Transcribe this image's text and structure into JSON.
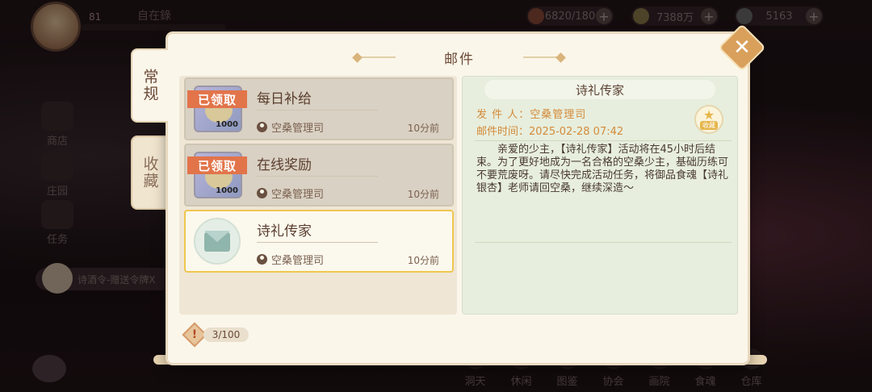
{
  "hud": {
    "level": "81",
    "name": "自在錄",
    "resources": [
      {
        "icon": "stamina-icon",
        "value": "6820/180"
      },
      {
        "icon": "coin-icon",
        "value": "7388万"
      },
      {
        "icon": "gem-icon",
        "value": "5163"
      }
    ]
  },
  "side": {
    "shop": "商店",
    "manor": "庄园",
    "tasks": "任务",
    "chat_preview": "诗酒令-赠送令牌X"
  },
  "bottom_nav": [
    "洞天",
    "休闲",
    "图鉴",
    "协会",
    "画院",
    "食魂",
    "仓库"
  ],
  "mail": {
    "title": "邮件",
    "tabs": {
      "normal": "常规",
      "favorites": "收藏"
    },
    "items": [
      {
        "title": "每日补给",
        "sender": "空桑管理司",
        "time": "10分前",
        "claimed_label": "已领取",
        "qty": "1000"
      },
      {
        "title": "在线奖励",
        "sender": "空桑管理司",
        "time": "10分前",
        "claimed_label": "已领取",
        "qty": "1000"
      },
      {
        "title": "诗礼传家",
        "sender": "空桑管理司",
        "time": "10分前"
      }
    ],
    "count": "3/100",
    "detail": {
      "title": "诗礼传家",
      "sender_line": "发 件 人：空桑管理司",
      "time_line": "邮件时间：2025-02-28  07:42",
      "favorite_label": "收藏",
      "body": "亲爱的少主，【诗礼传家】活动将在45小时后结束。为了更好地成为一名合格的空桑少主，基础历练可不要荒废呀。请尽快完成活动任务，将御品食魂【诗礼银杏】老师请回空桑，继续深造～"
    }
  }
}
